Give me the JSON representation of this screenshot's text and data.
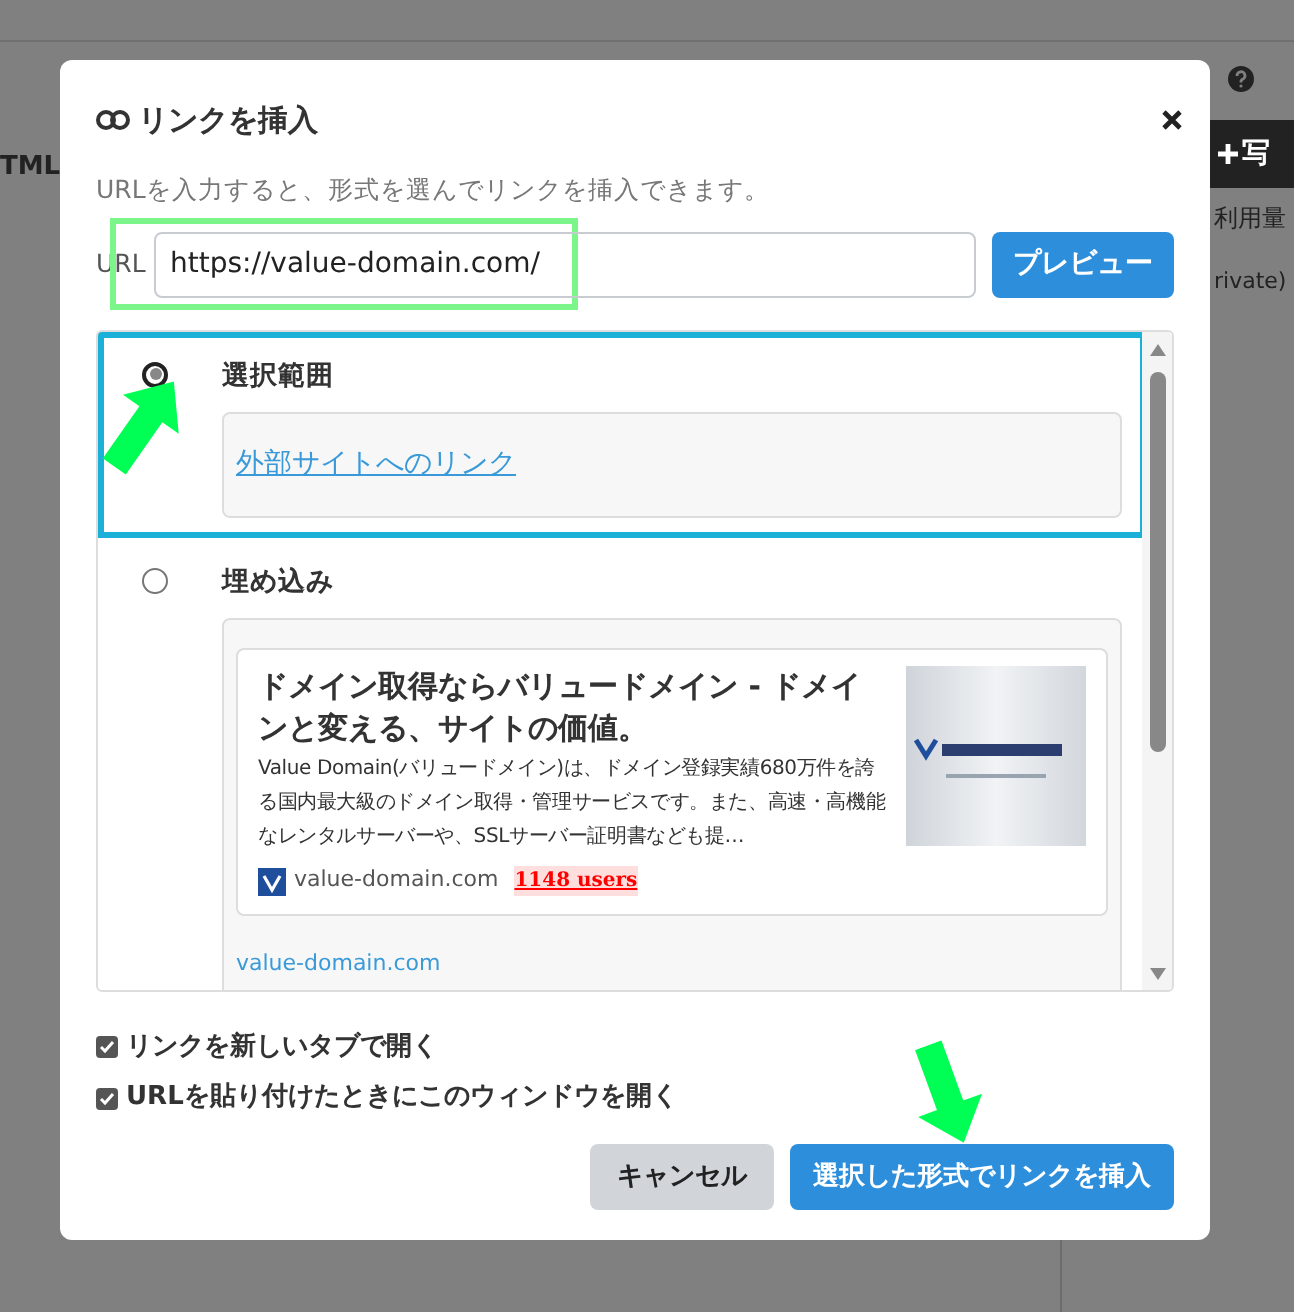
{
  "background": {
    "left_label": "TML",
    "right_button": "写",
    "right_label": "利用量",
    "right_select": "rivate)"
  },
  "dialog": {
    "title": "リンクを挿入",
    "description": "URLを入力すると、形式を選んでリンクを挿入できます。",
    "url": {
      "label": "URL",
      "value": "https://value-domain.com/"
    },
    "preview_button": "プレビュー",
    "options": [
      {
        "kind": "selection",
        "label": "選択範囲",
        "selected": true,
        "link_text": "外部サイトへのリンク"
      },
      {
        "kind": "embed",
        "label": "埋め込み",
        "selected": false,
        "card": {
          "title": "ドメイン取得ならバリュードメイン - ドメインと変える、サイトの価値。",
          "description": "Value Domain(バリュードメイン)は、ドメイン登録実績680万件を誇る国内最大級のドメイン取得・管理サービスです。また、高速・高機能なレンタルサーバーや、SSLサーバー証明書なども提…",
          "domain": "value-domain.com",
          "users": "1148 users"
        },
        "footer_link": "value-domain.com"
      }
    ],
    "checkboxes": [
      {
        "label": "リンクを新しいタブで開く",
        "checked": true
      },
      {
        "label": "URLを貼り付けたときにこのウィンドウを開く",
        "checked": true
      }
    ],
    "buttons": [
      {
        "kind": "secondary",
        "label": "キャンセル"
      },
      {
        "kind": "primary",
        "label": "選択した形式でリンクを挿入"
      }
    ]
  }
}
